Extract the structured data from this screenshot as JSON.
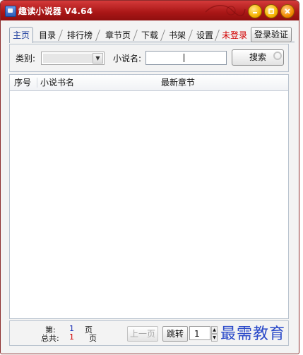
{
  "window": {
    "title": "趣读小说器 V4.64",
    "controls": [
      "minimize-icon",
      "restore-icon",
      "close-icon"
    ]
  },
  "tabs": [
    {
      "label": "主页",
      "active": true
    },
    {
      "label": "目录"
    },
    {
      "label": "排行榜"
    },
    {
      "label": "章节页"
    },
    {
      "label": "下载"
    },
    {
      "label": "书架"
    },
    {
      "label": "设置"
    }
  ],
  "login_status": "未登录",
  "login_verify_button": "登录验证",
  "search": {
    "category_label": "类别:",
    "category_value": "",
    "name_label": "小说名:",
    "name_value": "",
    "button": "搜索"
  },
  "list": {
    "columns": [
      "序号",
      "小说书名",
      "最新章节"
    ],
    "rows": []
  },
  "pager": {
    "current_prefix": "第:",
    "current_page": "1",
    "current_suffix": "页",
    "total_prefix": "总共:",
    "total_pages": "1",
    "total_suffix": "页",
    "prev_button": "上一页",
    "jump_button": "跳转",
    "jump_value": "1"
  },
  "watermark": "最需教育",
  "colors": {
    "titlebar": "#b01c1c",
    "login_status": "#d20000",
    "page_number": "#1a2fb5",
    "total_pages": "#d20000",
    "watermark": "#2a49c9"
  }
}
